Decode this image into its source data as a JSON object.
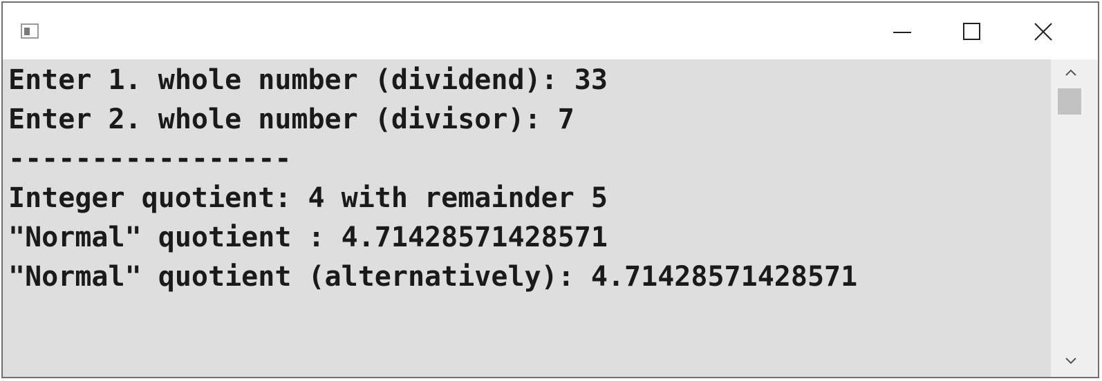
{
  "window": {
    "icon": "console-app-icon",
    "controls": {
      "minimize_icon": "minimize-icon",
      "maximize_icon": "maximize-icon",
      "close_icon": "close-icon"
    }
  },
  "console": {
    "background": "#dedede",
    "text_color": "#1a1a1a",
    "lines": [
      "Enter 1. whole number (dividend): 33",
      "Enter 2. whole number (divisor): 7",
      "-----------------",
      "Integer quotient: 4 with remainder 5",
      "\"Normal\" quotient : 4.71428571428571",
      "\"Normal\" quotient (alternatively): 4.71428571428571"
    ]
  },
  "scrollbar": {
    "up_icon": "chevron-up-icon",
    "down_icon": "chevron-down-icon"
  }
}
